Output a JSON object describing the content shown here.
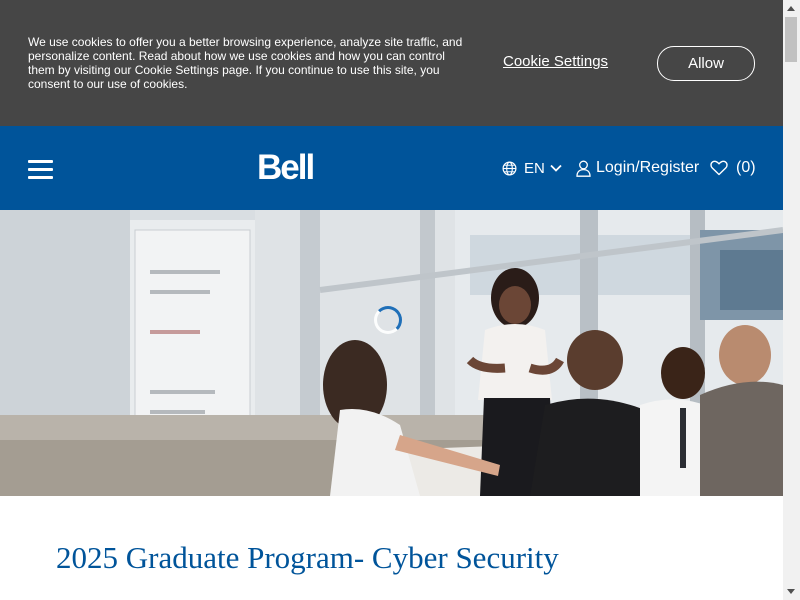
{
  "cookie_banner": {
    "text": "We use cookies to offer you a better browsing experience, analyze site traffic, and personalize content. Read about how we use cookies and how you can control them by visiting our Cookie Settings page. If you continue to use this site, you consent to our use of cookies.",
    "settings_label": "Cookie Settings",
    "allow_label": "Allow"
  },
  "header": {
    "logo_text": "Bell",
    "language_label": "EN",
    "login_label": "Login/Register",
    "cart_count": "(0)",
    "background_color": "#00549a",
    "icons": [
      "menu-icon",
      "globe-icon",
      "chevron-down-icon",
      "user-icon",
      "heart-icon"
    ]
  },
  "hero": {
    "image_description_icon": "meeting-photo",
    "loading_icon": "loading-spinner-icon"
  },
  "main": {
    "title": "2025 Graduate Program- Cyber Security"
  },
  "colors": {
    "cookie_banner_bg": "#464646",
    "brand_blue": "#00549a",
    "title_blue": "#00549a"
  }
}
